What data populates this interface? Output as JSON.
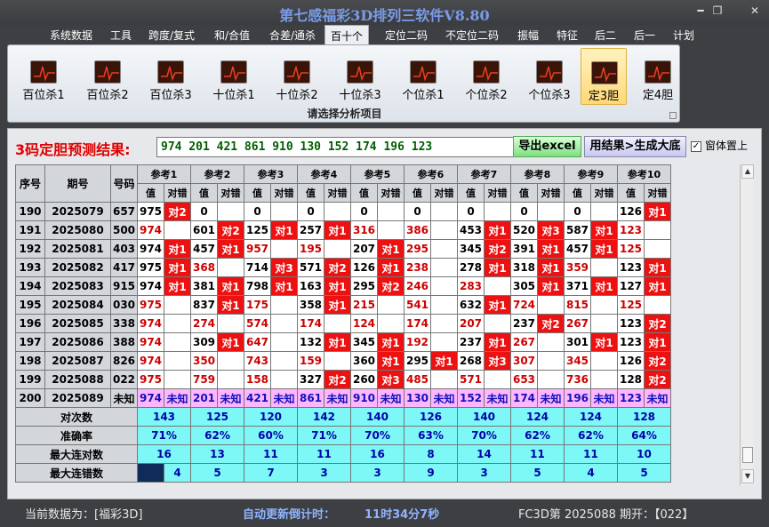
{
  "window": {
    "title": "第七感福彩3D排列三软件V8.80",
    "min": "━",
    "max": "❐",
    "close": "✕"
  },
  "menu": [
    "系统数据",
    "工具",
    "跨度/复式",
    "和/合值",
    "合差/通杀",
    "百十个",
    "定位二码",
    "不定位二码",
    "振幅",
    "特征",
    "后二",
    "后一",
    "计划"
  ],
  "ribbon": {
    "buttons": [
      "百位杀1",
      "百位杀2",
      "百位杀3",
      "十位杀1",
      "十位杀2",
      "十位杀3",
      "个位杀1",
      "个位杀2",
      "个位杀3",
      "定3胆",
      "定4胆"
    ],
    "active": "定3胆",
    "caption": "请选择分析项目"
  },
  "result": {
    "label": "3码定胆预测结果:",
    "value": "974  201  421  861  910  130  152  174  196  123",
    "excel": "导出excel",
    "gen": "用结果>生成大底",
    "ontop": "窗体置上",
    "ontop_check": "✓"
  },
  "table": {
    "headers": {
      "seq": "序号",
      "period": "期号",
      "code": "号码",
      "refs": [
        "参考1",
        "参考2",
        "参考3",
        "参考4",
        "参考5",
        "参考6",
        "参考7",
        "参考8",
        "参考9",
        "参考10"
      ],
      "val": "值",
      "mark": "对错"
    },
    "rows": [
      {
        "seq": "190",
        "period": "2025079",
        "code": "657",
        "cells": [
          "975",
          "对2",
          "0",
          "",
          "0",
          "",
          "0",
          "",
          "0",
          "",
          "0",
          "",
          "0",
          "",
          "0",
          "",
          "0",
          "",
          "126",
          "对1"
        ]
      },
      {
        "seq": "191",
        "period": "2025080",
        "code": "500",
        "cells": [
          "974",
          "",
          "601",
          "对2",
          "125",
          "对1",
          "257",
          "对1",
          "316",
          "",
          "386",
          "",
          "453",
          "对1",
          "520",
          "对3",
          "587",
          "对1",
          "123",
          ""
        ]
      },
      {
        "seq": "192",
        "period": "2025081",
        "code": "403",
        "cells": [
          "974",
          "对1",
          "457",
          "对1",
          "957",
          "",
          "195",
          "",
          "207",
          "对1",
          "295",
          "",
          "345",
          "对2",
          "391",
          "对1",
          "457",
          "对1",
          "125",
          ""
        ]
      },
      {
        "seq": "193",
        "period": "2025082",
        "code": "417",
        "cells": [
          "975",
          "对1",
          "368",
          "",
          "714",
          "对3",
          "571",
          "对2",
          "126",
          "对1",
          "238",
          "",
          "278",
          "对1",
          "318",
          "对1",
          "359",
          "",
          "123",
          "对1"
        ]
      },
      {
        "seq": "194",
        "period": "2025083",
        "code": "915",
        "cells": [
          "974",
          "对1",
          "381",
          "对1",
          "798",
          "对1",
          "163",
          "对1",
          "295",
          "对2",
          "246",
          "",
          "283",
          "",
          "305",
          "对1",
          "371",
          "对1",
          "127",
          "对1"
        ]
      },
      {
        "seq": "195",
        "period": "2025084",
        "code": "030",
        "cells": [
          "975",
          "",
          "837",
          "对1",
          "175",
          "",
          "358",
          "对1",
          "215",
          "",
          "541",
          "",
          "632",
          "对1",
          "724",
          "",
          "815",
          "",
          "125",
          ""
        ]
      },
      {
        "seq": "196",
        "period": "2025085",
        "code": "338",
        "cells": [
          "974",
          "",
          "274",
          "",
          "574",
          "",
          "174",
          "",
          "124",
          "",
          "174",
          "",
          "207",
          "",
          "237",
          "对2",
          "267",
          "",
          "123",
          "对2"
        ]
      },
      {
        "seq": "197",
        "period": "2025086",
        "code": "388",
        "cells": [
          "974",
          "",
          "309",
          "对1",
          "647",
          "",
          "132",
          "对1",
          "345",
          "对1",
          "192",
          "",
          "237",
          "对1",
          "267",
          "",
          "301",
          "对1",
          "123",
          "对1"
        ]
      },
      {
        "seq": "198",
        "period": "2025087",
        "code": "826",
        "cells": [
          "974",
          "",
          "350",
          "",
          "743",
          "",
          "159",
          "",
          "360",
          "对1",
          "295",
          "对1",
          "268",
          "对3",
          "307",
          "",
          "345",
          "",
          "126",
          "对2"
        ]
      },
      {
        "seq": "199",
        "period": "2025088",
        "code": "022",
        "cells": [
          "975",
          "",
          "759",
          "",
          "158",
          "",
          "327",
          "对2",
          "260",
          "对3",
          "485",
          "",
          "571",
          "",
          "653",
          "",
          "736",
          "",
          "128",
          "对2"
        ]
      },
      {
        "seq": "200",
        "period": "2025089",
        "code": "未知",
        "cells": [
          "974",
          "未知",
          "201",
          "未知",
          "421",
          "未知",
          "861",
          "未知",
          "910",
          "未知",
          "130",
          "未知",
          "152",
          "未知",
          "174",
          "未知",
          "196",
          "未知",
          "123",
          "未知"
        ]
      }
    ],
    "hits": {
      "190": [
        "对2",
        "",
        "",
        "",
        "",
        "",
        "",
        "",
        "",
        "对1"
      ]
    },
    "stats": [
      {
        "label": "对次数",
        "values": [
          "143",
          "125",
          "120",
          "142",
          "140",
          "126",
          "140",
          "124",
          "124",
          "128"
        ]
      },
      {
        "label": "准确率",
        "values": [
          "71%",
          "62%",
          "60%",
          "71%",
          "70%",
          "63%",
          "70%",
          "62%",
          "62%",
          "64%"
        ]
      },
      {
        "label": "最大连对数",
        "values": [
          "16",
          "13",
          "11",
          "11",
          "16",
          "8",
          "14",
          "11",
          "11",
          "10"
        ]
      },
      {
        "label": "最大连错数",
        "values": [
          "4",
          "5",
          "7",
          "3",
          "3",
          "9",
          "3",
          "5",
          "4",
          "5"
        ]
      }
    ]
  },
  "scrollbar": {
    "up": "▲",
    "down": "▼"
  },
  "status": {
    "data": "当前数据为：[福彩3D]",
    "countdown_label": "自动更新倒计时：",
    "countdown": "11时34分7秒",
    "latest": "FC3D第 2025088 期开：【022】"
  },
  "colors": {
    "title": "#7a9be8",
    "hit": "#ee1111",
    "latest_row": "#ffb6ff",
    "stats": "#7ef7f7",
    "status_blue": "#8fb4ff"
  }
}
